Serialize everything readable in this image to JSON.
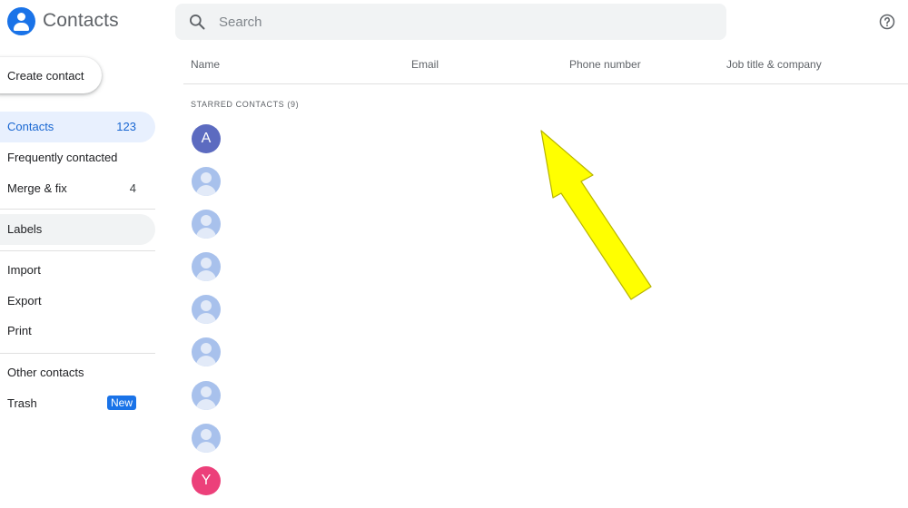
{
  "header": {
    "app_title": "Contacts",
    "search_placeholder": "Search"
  },
  "sidebar": {
    "create_label": "Create contact",
    "items": [
      {
        "label": "Contacts",
        "count": "123"
      },
      {
        "label": "Frequently contacted",
        "count": ""
      },
      {
        "label": "Merge & fix",
        "count": "4"
      },
      {
        "label": "Labels",
        "count": ""
      },
      {
        "label": "Import",
        "count": ""
      },
      {
        "label": "Export",
        "count": ""
      },
      {
        "label": "Print",
        "count": ""
      },
      {
        "label": "Other contacts",
        "count": ""
      },
      {
        "label": "Trash",
        "badge": "New"
      }
    ]
  },
  "table": {
    "columns": [
      "Name",
      "Email",
      "Phone number",
      "Job title & company"
    ],
    "section_label": "STARRED CONTACTS (9)",
    "rows": [
      {
        "initial": "A",
        "color": "#5c6bc0"
      },
      {
        "initial": ""
      },
      {
        "initial": ""
      },
      {
        "initial": ""
      },
      {
        "initial": ""
      },
      {
        "initial": ""
      },
      {
        "initial": ""
      },
      {
        "initial": ""
      },
      {
        "initial": "Y",
        "color": "#ec407a"
      }
    ]
  },
  "colors": {
    "accent": "#1a73e8",
    "active_bg": "#e8f0fe",
    "arrow_annotation": "#ffff00"
  }
}
